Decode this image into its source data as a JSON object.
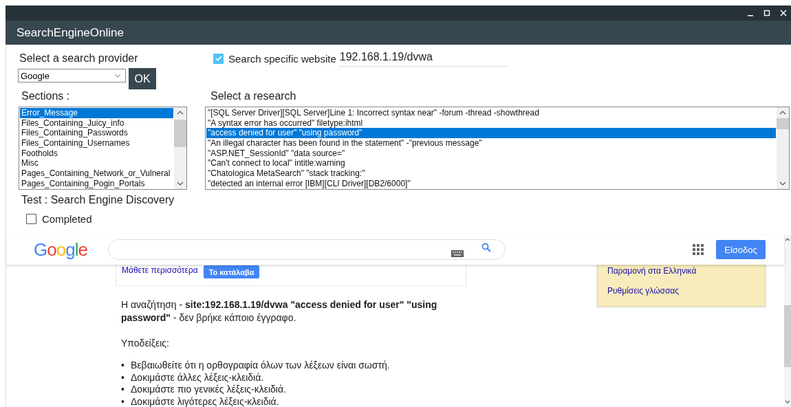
{
  "window": {
    "title": "SearchEngineOnline"
  },
  "provider": {
    "label": "Select a search provider",
    "value": "Google",
    "button": "OK"
  },
  "site_filter": {
    "label": "Search specific website",
    "checked": true,
    "value": "192.168.1.19/dvwa"
  },
  "sections": {
    "label": "Sections :",
    "items": [
      {
        "text": "Error_Message",
        "selected": true
      },
      {
        "text": "Files_Containing_Juicy_info",
        "selected": false
      },
      {
        "text": "Files_Containing_Passwords",
        "selected": false
      },
      {
        "text": "Files_Containing_Usernames",
        "selected": false
      },
      {
        "text": "Footholds",
        "selected": false
      },
      {
        "text": "Misc",
        "selected": false
      },
      {
        "text": "Pages_Containing_Network_or_Vulneral",
        "selected": false
      },
      {
        "text": "Pages_Containing_Pogin_Portals",
        "selected": false
      }
    ]
  },
  "research": {
    "label": "Select a research",
    "items": [
      {
        "text": "\"[SQL Server Driver][SQL Server]Line 1: Incorrect syntax near\" -forum -thread -showthread",
        "selected": false
      },
      {
        "text": "\"A syntax error has occurred\" filetype:ihtml",
        "selected": false
      },
      {
        "text": "\"access denied for user\" \"using password\"",
        "selected": true
      },
      {
        "text": "\"An illegal character has been found in the statement\" -\"previous message\"",
        "selected": false
      },
      {
        "text": "\"ASP.NET_SessionId\" \"data source=\"",
        "selected": false
      },
      {
        "text": "\"Can't connect to local\" intitle:warning",
        "selected": false
      },
      {
        "text": "\"Chatologica MetaSearch\" \"stack tracking:\"",
        "selected": false
      },
      {
        "text": "\"detected an internal error [IBM][CLI Driver][DB2/6000]\"",
        "selected": false
      }
    ]
  },
  "test": {
    "title": "Test : Search Engine Discovery",
    "completed": {
      "label": "Completed",
      "checked": false
    }
  },
  "browser": {
    "logo": "Google",
    "signin": "Είσοδος",
    "notice": {
      "link": "Μάθετε περισσότερα",
      "button": "Το κατάλαβα"
    },
    "language_popup": [
      "Παραμονή στα Ελληνικά",
      "Ρυθμίσεις γλώσσας"
    ],
    "message": "Η αναζήτηση - **site:192.168.1.19/dvwa \"access denied for user\" \"using password\"** - δεν βρήκε κάποιο έγγραφο.",
    "hints_title": "Υποδείξεις:",
    "hints": [
      {
        "bullet": "•",
        "text": "Βεβαιωθείτε ότι η ορθογραφία όλων των λέξεων είναι σωστή."
      },
      {
        "bullet": "•",
        "text": "Δοκιμάστε άλλες λέξεις-κλειδιά."
      },
      {
        "bullet": "•",
        "text": "Δοκιμάστε πιο γενικές λέξεις-κλειδιά."
      },
      {
        "bullet": "•",
        "text": "Δοκιμάστε λιγότερες λέξεις-κλειδιά."
      }
    ]
  }
}
